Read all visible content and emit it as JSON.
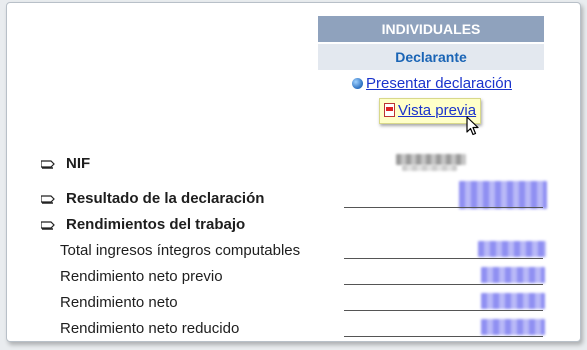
{
  "column": {
    "header": "INDIVIDUALES",
    "subheader": "Declarante"
  },
  "actions": {
    "present_label": "Presentar declaración",
    "present_icon": "globe-icon",
    "preview_label": "Vista previa",
    "preview_icon": "pdf-icon"
  },
  "rows": [
    {
      "label": "NIF",
      "bold": true,
      "bullet": true
    },
    {
      "label": "Resultado de la declaración",
      "bold": true,
      "bullet": true
    },
    {
      "label": "Rendimientos del trabajo",
      "bold": true,
      "bullet": true
    },
    {
      "label": "Total ingresos íntegros computables",
      "bold": false,
      "bullet": false
    },
    {
      "label": "Rendimiento neto previo",
      "bold": false,
      "bullet": false
    },
    {
      "label": "Rendimiento neto",
      "bold": false,
      "bullet": false
    },
    {
      "label": "Rendimiento neto reducido",
      "bold": false,
      "bullet": false
    }
  ],
  "colors": {
    "header_bg": "#8fa2bd",
    "subheader_bg": "#e3e8ef",
    "subheader_text": "#1a64b5",
    "link": "#1a33cc",
    "tooltip_bg": "#ffffc8"
  }
}
